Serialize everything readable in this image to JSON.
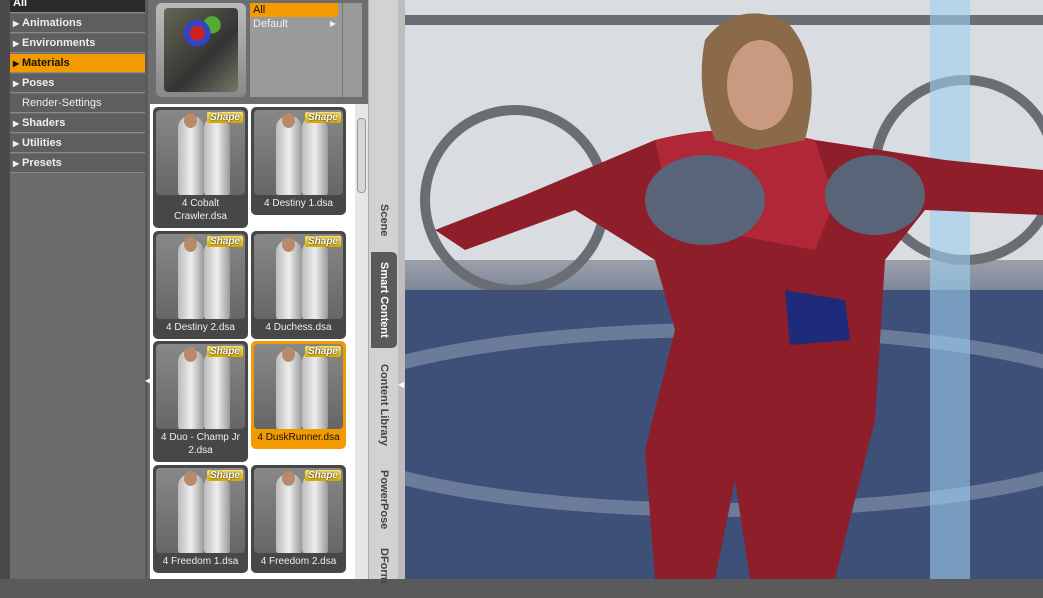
{
  "categories": [
    {
      "label": "All",
      "arrow": false
    },
    {
      "label": "Animations",
      "arrow": true
    },
    {
      "label": "Environments",
      "arrow": true
    },
    {
      "label": "Materials",
      "arrow": true,
      "selected": true
    },
    {
      "label": "Poses",
      "arrow": true
    },
    {
      "label": "Render-Settings",
      "arrow": false
    },
    {
      "label": "Shaders",
      "arrow": true
    },
    {
      "label": "Utilities",
      "arrow": true
    },
    {
      "label": "Presets",
      "arrow": true
    }
  ],
  "sublist": [
    {
      "label": "All",
      "selected": true
    },
    {
      "label": "Default",
      "arrow": "▶"
    }
  ],
  "badge": "Shape",
  "items": [
    {
      "label": "4 Cobalt Crawler.dsa"
    },
    {
      "label": "4 Destiny 1.dsa"
    },
    {
      "label": "4 Destiny 2.dsa"
    },
    {
      "label": "4 Duchess.dsa"
    },
    {
      "label": "4 Duo - Champ Jr 2.dsa"
    },
    {
      "label": "4 DuskRunner.dsa",
      "selected": true
    },
    {
      "label": "4 Freedom 1.dsa"
    },
    {
      "label": "4 Freedom 2.dsa"
    }
  ],
  "tabs": [
    {
      "label": "Scene"
    },
    {
      "label": "Smart Content",
      "active": true
    },
    {
      "label": "Content Library"
    },
    {
      "label": "PowerPose"
    },
    {
      "label": "DForm"
    }
  ],
  "colors": {
    "accent": "#f39a00",
    "panel": "#6b6b6b"
  }
}
